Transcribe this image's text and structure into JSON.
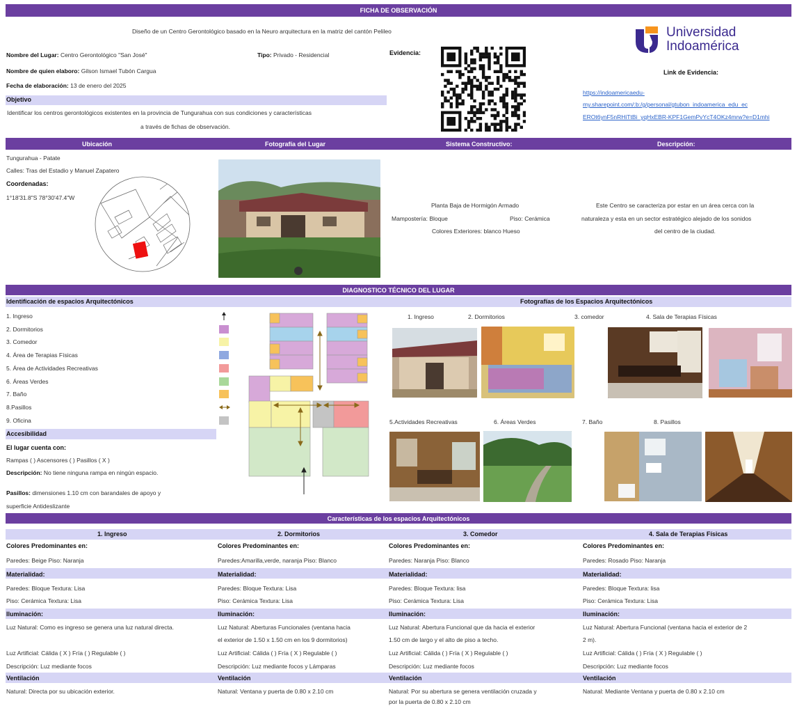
{
  "title_bar": "FICHA DE OBSERVACIÓN",
  "subtitle": "Diseño de un Centro Gerontológico basado en la Neuro arquitectura en la matriz del cantón Pelileo",
  "logo": {
    "line1": "Universidad",
    "line2": "Indoamérica"
  },
  "meta": {
    "place_label": "Nombre del Lugar:",
    "place_value": "Centro Gerontológico \"San José\"",
    "type_label": "Tipo:",
    "type_value": "Privado - Residencial",
    "author_label": "Nombre de quien elaboro:",
    "author_value": "Gilson Ismael Tubón Cargua",
    "date_label": "Fecha de elaboración:",
    "date_value": "13 de enero del 2025",
    "evidence_label": "Evidencia:",
    "objective_label": "Objetivo",
    "objective_text_1": "Identificar los centros gerontológicos existentes en la provincia de Tungurahua con sus condiciones y características",
    "objective_text_2": "a través de fichas de observación.",
    "link_label": "Link de Evidencia:",
    "link_1": "https://indoamericaedu-",
    "link_2": "my.sharepoint.com/:b:/g/personal/gtubon_indoamerica_edu_ec",
    "link_3": "EROt6ynF5nRHiTtBi_yqHxEBR-KPF1GemPvYcT4OKz4mrw?e=D1mhi"
  },
  "section_headers": {
    "location": "Ubicación",
    "photo": "Fotografía del Lugar",
    "construction": "Sistema Constructivo:",
    "description": "Descripción:"
  },
  "location": {
    "line1": "Tungurahua - Patate",
    "line2": "Calles: Tras del Estadio y Manuel Zapatero",
    "coords_label": "Coordenadas:",
    "coords": "1°18'31.8\"S 78°30'47.4\"W"
  },
  "construction": {
    "line1": "Planta Baja de Hormigón Armado",
    "line2a": "Mampostería: Bloque",
    "line2b": "Piso: Cerámica",
    "line3": "Colores Exteriores: blanco Hueso"
  },
  "description": {
    "line1": "Este Centro se caracteriza por estar en un área cerca con la",
    "line2": "naturaleza y esta en un sector estratégico alejado de los sonidos",
    "line3": "del centro de la ciudad."
  },
  "diagnostic_bar": "DIAGNOSTICO TÉCNICO DEL LUGAR",
  "spaces_header": "Identificación de espacios Arquitectónicos",
  "photos_header": "Fotografías de los Espacios Arquitectónicos",
  "spaces": [
    {
      "label": "1. Ingreso",
      "color": "arrow"
    },
    {
      "label": "2. Dormitorios",
      "color": "#c98fd0"
    },
    {
      "label": "3. Comedor",
      "color": "#f7f3a6"
    },
    {
      "label": "4. Área de Terapias Físicas",
      "color": "#8fa8e0"
    },
    {
      "label": "5. Área de Actividades Recreativas",
      "color": "#f29a9a"
    },
    {
      "label": "6. Áreas Verdes",
      "color": "#a9d89a"
    },
    {
      "label": "7. Baño",
      "color": "#f7c25a"
    },
    {
      "label": "8.Pasillos",
      "color": "harrow"
    },
    {
      "label": "9. Oficina",
      "color": "#c4c4c4"
    }
  ],
  "accessibility": {
    "title": "Accesibilidad",
    "has_label": "El lugar cuenta con:",
    "options": "Rampas (  )    Ascensores  (  )  Pasillos  ( X )",
    "desc_label": "Descripción:",
    "desc_text": " No tiene ninguna rampa en ningún espacio.",
    "pas_label": "Pasillos:",
    "pas_text_1": " dimensiones 1.10 cm con barandales de apoyo y",
    "pas_text_2": "superficie Antideslizante"
  },
  "photo_captions_top": [
    "1. Ingreso",
    "2. Dormitorios",
    "3. comedor",
    "4. Sala de Terapias Físicas"
  ],
  "photo_captions_bottom": [
    "5.Actividades Recreativas",
    "6. Áreas Verdes",
    "7. Baño",
    "8. Pasillos"
  ],
  "characteristics_bar": "Características de los espacios Arquitectónicos",
  "columns": [
    {
      "title": "1. Ingreso",
      "colors_label": "Colores Predominantes en:",
      "colors": "Paredes: Beige    Piso: Naranja",
      "mat_label": "Materialidad:",
      "mat1": "Paredes: Bloque         Textura: Lisa",
      "mat2": "Piso: Cerámica   Textura: Lisa",
      "ilum_label": "Iluminación:",
      "ilum1": "Luz Natural: Como es ingreso se genera una luz natural directa.",
      "ilum2": "",
      "ilum3": "Luz Artificial: Cálida ( X )  Fría (  )  Regulable (  )",
      "ilum4": "Descripción: Luz mediante focos",
      "vent_label": "Ventilación",
      "vent1": "Natural: Directa por su ubicación exterior.",
      "vent2": ""
    },
    {
      "title": "2. Dormitorios",
      "colors_label": "Colores Predominantes en:",
      "colors": "Paredes:Amarilla,verde, naranja   Piso: Blanco",
      "mat_label": "Materialidad:",
      "mat1": "Paredes: Bloque       Textura: Lisa",
      "mat2": "Piso: Cerámica  Textura: Lisa",
      "ilum_label": "Iluminación:",
      "ilum1": "Luz Natural: Aberturas Funcionales (ventana hacia",
      "ilum2": "el exterior de 1.50 x 1.50 cm en los 9 dormitorios)",
      "ilum3": "Luz Artificial: Cálida (  )  Fría ( X )  Regulable (  )",
      "ilum4": "Descripción: Luz mediante focos y Lámparas",
      "vent_label": "Ventilación",
      "vent1": "Natural: Ventana y puerta de 0.80 x 2.10 cm",
      "vent2": ""
    },
    {
      "title": "3. Comedor",
      "colors_label": "Colores Predominantes en:",
      "colors": "Paredes: Naranja    Piso: Blanco",
      "mat_label": "Materialidad:",
      "mat1": "Paredes: Bloque    Textura: lisa",
      "mat2": "Piso: Cerámica  Textura: Lisa",
      "ilum_label": "Iluminación:",
      "ilum1": "Luz Natural: Abertura Funcional que da hacia el exterior",
      "ilum2": "1.50 cm de largo y el alto de piso a techo.",
      "ilum3": "Luz Artificial: Cálida (  )  Fría ( X )  Regulable (  )",
      "ilum4": "Descripción: Luz mediante focos",
      "vent_label": "Ventilación",
      "vent1": "Natural: Por su abertura se genera ventilación cruzada y",
      "vent2": "por la puerta de 0.80 x 2.10 cm"
    },
    {
      "title": "4. Sala de Terapias Físicas",
      "colors_label": "Colores Predominantes en:",
      "colors": "Paredes: Rosado   Piso: Naranja",
      "mat_label": "Materialidad:",
      "mat1": "Paredes: Bloque    Textura: lisa",
      "mat2": "Piso: Cerámica  Textura: Lisa",
      "ilum_label": "Iluminación:",
      "ilum1": "Luz Natural: Abertura Funcional (ventana hacia el exterior de      2",
      "ilum2": "2 m).",
      "ilum3": "Luz Artificial: Cálida (  )  Fría (  X )  Regulable (  )",
      "ilum4": "Descripción: Luz mediante focos",
      "vent_label": "Ventilación",
      "vent1": "Natural: Mediante Ventana y puerta de 0.80 x 2.10 cm",
      "vent2": ""
    }
  ]
}
